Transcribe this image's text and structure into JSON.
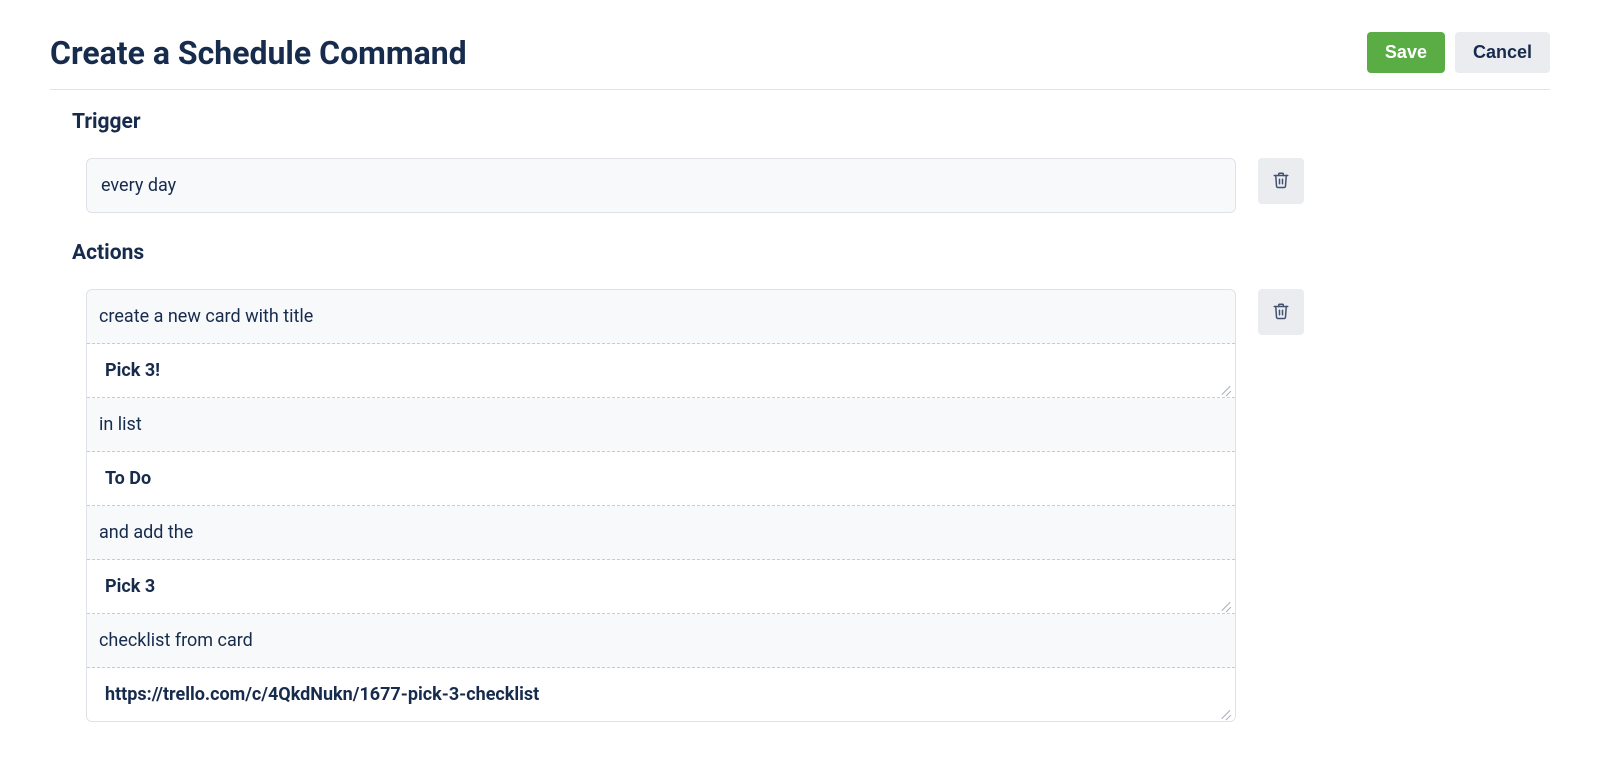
{
  "header": {
    "title": "Create a Schedule Command",
    "save_label": "Save",
    "cancel_label": "Cancel"
  },
  "trigger": {
    "section_label": "Trigger",
    "value": "every day"
  },
  "actions": {
    "section_label": "Actions",
    "segments": [
      {
        "type": "text",
        "value": "create a new card with title"
      },
      {
        "type": "input",
        "value": "Pick 3!"
      },
      {
        "type": "text",
        "value": "in list"
      },
      {
        "type": "input",
        "value": "To Do"
      },
      {
        "type": "text",
        "value": "and add the"
      },
      {
        "type": "input",
        "value": "Pick 3"
      },
      {
        "type": "text",
        "value": "checklist from card"
      },
      {
        "type": "input",
        "value": "https://trello.com/c/4QkdNukn/1677-pick-3-checklist"
      }
    ]
  },
  "icons": {
    "trash": "trash"
  }
}
